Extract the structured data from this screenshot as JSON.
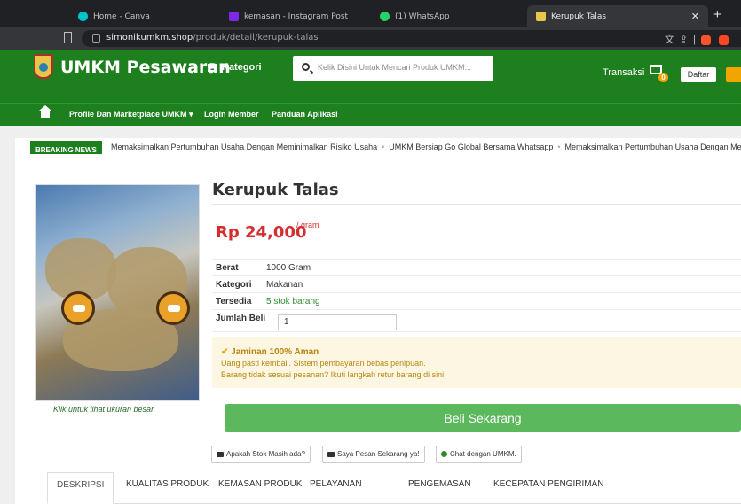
{
  "browser": {
    "tabs": [
      {
        "title": "Home - Canva",
        "color": "#00c4cc"
      },
      {
        "title": "kemasan - Instagram Post",
        "color": "#7d2ae8"
      },
      {
        "title": "(1) WhatsApp",
        "color": "#25d366"
      },
      {
        "title": "Kerupuk Talas",
        "color": "#e8c64a",
        "active": true
      }
    ],
    "url_host": "simonikumkm.shop",
    "url_path": "/produk/detail/kerupuk-talas"
  },
  "header": {
    "brand": "UMKM Pesawaran",
    "kategori": "Kategori",
    "search_placeholder": "Kelik Disini Untuk Mencari Produk UMKM...",
    "transaksi": "Transaksi",
    "cart_count": "0",
    "daftar": "Daftar"
  },
  "nav": {
    "items": [
      "Profile Dan Marketplace UMKM ▾",
      "Login Member",
      "Panduan Aplikasi"
    ]
  },
  "breaking": {
    "label": "BREAKING NEWS",
    "items": [
      "Memaksimalkan Pertumbuhan Usaha Dengan Meminimalkan Risiko Usaha",
      "UMKM Bersiap Go Global Bersama Whatsapp",
      "Memaksimalkan Pertumbuhan Usaha Dengan Meminimalkan Risiko Usaha"
    ]
  },
  "product": {
    "image_caption": "Klik untuk lihat ukuran besar.",
    "title": "Kerupuk Talas",
    "price": "Rp 24,000",
    "unit": "/ gram",
    "specs": [
      {
        "label": "Berat",
        "value": "1000 Gram"
      },
      {
        "label": "Kategori",
        "value": "Makanan"
      },
      {
        "label": "Tersedia",
        "value": "5 stok barang"
      }
    ],
    "qty_label": "Jumlah Beli",
    "qty_value": "1",
    "guarantee_title": "Jaminan 100% Aman",
    "guarantee_lines": [
      "Uang pasti kembali. Sistem pembayaran bebas penipuan.",
      "Barang tidak sesuai pesanan? Ikuti langkah retur barang di sini."
    ],
    "buy_label": "Beli Sekarang",
    "chips": [
      "Apakah Stok Masih ada?",
      "Saya Pesan Sekarang ya!",
      "Chat dengan UMKM."
    ]
  },
  "tabs": [
    "DESKRIPSI",
    "KUALITAS PRODUK",
    "KEMASAN PRODUK",
    "PELAYANAN",
    "PENGEMASAN",
    "KECEPATAN PENGIRIMAN"
  ]
}
